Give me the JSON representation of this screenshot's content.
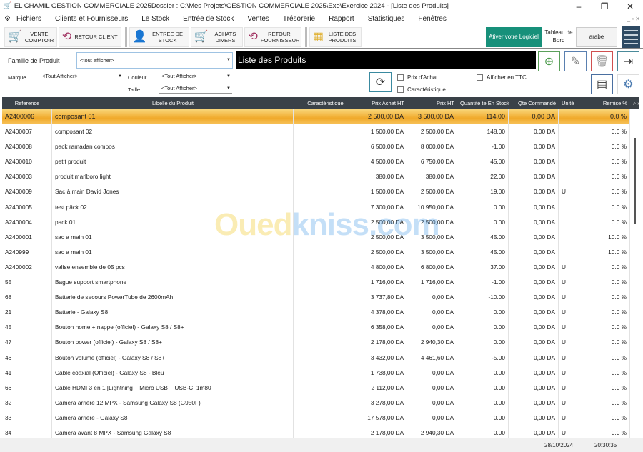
{
  "window": {
    "title": "EL CHAMIL GESTION COMMERCIALE 2025Dossier : C:\\Mes Projets\\GESTION COMMERCIALE 2025\\Exe\\Exercice 2024 - [Liste des Produits]",
    "min": "–",
    "max": "❐",
    "close": "✕"
  },
  "menu": [
    "Fichiers",
    "Clients et Fournisseurs",
    "Le Stock",
    "Entrée de Stock",
    "Ventes",
    "Trésorerie",
    "Rapport",
    "Statistiques",
    "Fenêtres"
  ],
  "toolbar": {
    "vente": "VENTE COMPTOIR",
    "retour_client": "RETOUR CLIENT",
    "entree": "ENTREE DE STOCK",
    "achats": "ACHATS DIVERS",
    "retour_f": "RETOUR FOURNISSEUR",
    "liste": "LISTE DES PRODUITS",
    "activer": "Ativer votre Logiciel",
    "tableau": "Tableau de Bord",
    "arabe": "arabe"
  },
  "filters": {
    "famille_label": "Famille de Produit",
    "famille_value": "<tout afficher>",
    "marque_label": "Marque",
    "marque_value": "<Tout Afficher>",
    "couleur_label": "Couleur",
    "couleur_value": "<Tout Afficher>",
    "taille_label": "Taille",
    "taille_value": "<Tout Afficher>",
    "banner": "Liste des Produits",
    "prix_achat": "Prix d'Achat",
    "caracteristique": "Caractéristique",
    "ttc": "Afficher en TTC"
  },
  "colors": {
    "header": "#3a4148",
    "selected": "#f0a92a",
    "activer": "#17907a"
  },
  "table": {
    "headers": [
      "Reference",
      "Libellé du Produit",
      "Caractéristique",
      "Prix Achat HT",
      "Prix HT",
      "Quantité te En Stock",
      "Qte Commandé",
      "Unité",
      "Remise %"
    ],
    "rows": [
      [
        "A2400006",
        "composant 01",
        "",
        "2 500,00 DA",
        "3 500,00 DA",
        "114.00",
        "0,00 DA",
        "",
        "0.0 %"
      ],
      [
        "A2400007",
        "composant 02",
        "",
        "1 500,00 DA",
        "2 500,00 DA",
        "148.00",
        "0,00 DA",
        "",
        "0.0 %"
      ],
      [
        "A2400008",
        "pack ramadan compos",
        "",
        "6 500,00 DA",
        "8 000,00 DA",
        "-1.00",
        "0,00 DA",
        "",
        "0.0 %"
      ],
      [
        "A2400010",
        "petit produit",
        "",
        "4 500,00 DA",
        "6 750,00 DA",
        "45.00",
        "0,00 DA",
        "",
        "0.0 %"
      ],
      [
        "A2400003",
        "produit marlboro light",
        "",
        "380,00 DA",
        "380,00 DA",
        "22.00",
        "0,00 DA",
        "",
        "0.0 %"
      ],
      [
        "A2400009",
        "Sac à main David Jones",
        "",
        "1 500,00 DA",
        "2 500,00 DA",
        "19.00",
        "0,00 DA",
        "U",
        "0.0 %"
      ],
      [
        "A2400005",
        "test päck 02",
        "",
        "7 300,00 DA",
        "10 950,00 DA",
        "0.00",
        "0,00 DA",
        "",
        "0.0 %"
      ],
      [
        "A2400004",
        "pack 01",
        "",
        "2 500,00 DA",
        "2 500,00 DA",
        "0.00",
        "0,00 DA",
        "",
        "0.0 %"
      ],
      [
        "A2400001",
        "sac a main 01",
        "",
        "2 500,00 DA",
        "3 500,00 DA",
        "45.00",
        "0,00 DA",
        "",
        "10.0 %"
      ],
      [
        "A240999",
        "sac a main 01",
        "",
        "2 500,00 DA",
        "3 500,00 DA",
        "45.00",
        "0,00 DA",
        "",
        "10.0 %"
      ],
      [
        "A2400002",
        "valise ensemble de 05 pcs",
        "",
        "4 800,00 DA",
        "6 800,00 DA",
        "37.00",
        "0,00 DA",
        "U",
        "0.0 %"
      ],
      [
        "55",
        "Bague support smartphone",
        "",
        "1 716,00 DA",
        "1 716,00 DA",
        "-1.00",
        "0,00 DA",
        "U",
        "0.0 %"
      ],
      [
        "68",
        "Batterie de secours PowerTube de 2600mAh",
        "",
        "3 737,80 DA",
        "0,00 DA",
        "-10.00",
        "0,00 DA",
        "U",
        "0.0 %"
      ],
      [
        "21",
        "Batterie - Galaxy S8",
        "",
        "4 378,00 DA",
        "0,00 DA",
        "0.00",
        "0,00 DA",
        "U",
        "0.0 %"
      ],
      [
        "45",
        "Bouton home + nappe (officiel) - Galaxy S8 / S8+",
        "",
        "6 358,00 DA",
        "0,00 DA",
        "0.00",
        "0,00 DA",
        "U",
        "0.0 %"
      ],
      [
        "47",
        "Bouton power (officiel) - Galaxy S8 / S8+",
        "",
        "2 178,00 DA",
        "2 940,30 DA",
        "0.00",
        "0,00 DA",
        "U",
        "0.0 %"
      ],
      [
        "46",
        "Bouton volume (officiel) - Galaxy S8 / S8+",
        "",
        "3 432,00 DA",
        "4 461,60 DA",
        "-5.00",
        "0,00 DA",
        "U",
        "0.0 %"
      ],
      [
        "41",
        "Câble coaxial (Officiel) - Galaxy S8 - Bleu",
        "",
        "1 738,00 DA",
        "0,00 DA",
        "0.00",
        "0,00 DA",
        "U",
        "0.0 %"
      ],
      [
        "66",
        "Câble HDMI 3 en 1 [Lightning + Micro USB + USB-C] 1m80",
        "",
        "2 112,00 DA",
        "0,00 DA",
        "0.00",
        "0,00 DA",
        "U",
        "0.0 %"
      ],
      [
        "32",
        "Caméra arrière 12 MPX - Samsung Galaxy S8 (G950F)",
        "",
        "3 278,00 DA",
        "0,00 DA",
        "0.00",
        "0,00 DA",
        "U",
        "0.0 %"
      ],
      [
        "33",
        "Caméra arrière - Galaxy S8",
        "",
        "17 578,00 DA",
        "0,00 DA",
        "0.00",
        "0,00 DA",
        "U",
        "0.0 %"
      ],
      [
        "34",
        "Caméra avant 8 MPX - Samsung Galaxy S8",
        "",
        "2 178,00 DA",
        "2 940,30 DA",
        "0.00",
        "0,00 DA",
        "U",
        "0.0 %"
      ]
    ]
  },
  "status": {
    "date": "28/10/2024",
    "time": "20:30:35"
  }
}
